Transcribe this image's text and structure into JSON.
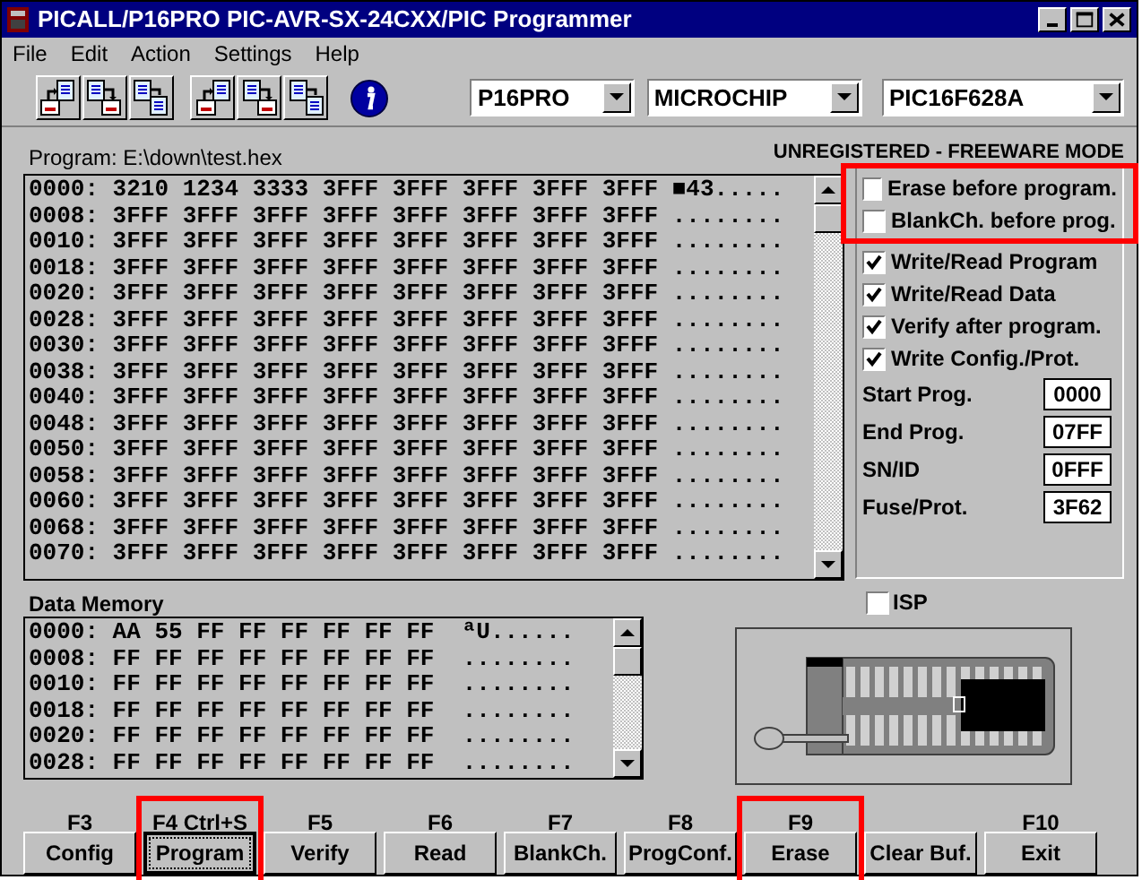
{
  "window": {
    "title": "PICALL/P16PRO PIC-AVR-SX-24CXX/PIC Programmer"
  },
  "menu": [
    "File",
    "Edit",
    "Action",
    "Settings",
    "Help"
  ],
  "toolbar": {
    "buttons": [
      {
        "kind": "load"
      },
      {
        "kind": "save"
      },
      {
        "kind": "saveas"
      },
      {
        "kind": "load"
      },
      {
        "kind": "save"
      },
      {
        "kind": "saveas"
      },
      {
        "kind": "info"
      }
    ],
    "dropdowns": [
      {
        "value": "P16PRO"
      },
      {
        "value": "MICROCHIP"
      },
      {
        "value": "PIC16F628A"
      }
    ]
  },
  "program": {
    "label": "Program: E:\\down\\test.hex",
    "mode": "UNREGISTERED - FREEWARE MODE",
    "lines": [
      "0000: 3210 1234 3333 3FFF 3FFF 3FFF 3FFF 3FFF ■43.....",
      "0008: 3FFF 3FFF 3FFF 3FFF 3FFF 3FFF 3FFF 3FFF ........",
      "0010: 3FFF 3FFF 3FFF 3FFF 3FFF 3FFF 3FFF 3FFF ........",
      "0018: 3FFF 3FFF 3FFF 3FFF 3FFF 3FFF 3FFF 3FFF ........",
      "0020: 3FFF 3FFF 3FFF 3FFF 3FFF 3FFF 3FFF 3FFF ........",
      "0028: 3FFF 3FFF 3FFF 3FFF 3FFF 3FFF 3FFF 3FFF ........",
      "0030: 3FFF 3FFF 3FFF 3FFF 3FFF 3FFF 3FFF 3FFF ........",
      "0038: 3FFF 3FFF 3FFF 3FFF 3FFF 3FFF 3FFF 3FFF ........",
      "0040: 3FFF 3FFF 3FFF 3FFF 3FFF 3FFF 3FFF 3FFF ........",
      "0048: 3FFF 3FFF 3FFF 3FFF 3FFF 3FFF 3FFF 3FFF ........",
      "0050: 3FFF 3FFF 3FFF 3FFF 3FFF 3FFF 3FFF 3FFF ........",
      "0058: 3FFF 3FFF 3FFF 3FFF 3FFF 3FFF 3FFF 3FFF ........",
      "0060: 3FFF 3FFF 3FFF 3FFF 3FFF 3FFF 3FFF 3FFF ........",
      "0068: 3FFF 3FFF 3FFF 3FFF 3FFF 3FFF 3FFF 3FFF ........",
      "0070: 3FFF 3FFF 3FFF 3FFF 3FFF 3FFF 3FFF 3FFF ........"
    ]
  },
  "options": [
    {
      "label": "Erase before program.",
      "checked": false,
      "highlighted": true
    },
    {
      "label": "BlankCh. before prog.",
      "checked": false,
      "highlighted": true
    },
    {
      "label": "Write/Read Program",
      "checked": true,
      "highlighted": false
    },
    {
      "label": "Write/Read Data",
      "checked": true,
      "highlighted": false
    },
    {
      "label": "Verify after program.",
      "checked": true,
      "highlighted": false
    },
    {
      "label": "Write Config./Prot.",
      "checked": true,
      "highlighted": false
    }
  ],
  "fields": [
    {
      "label": "Start Prog.",
      "value": "0000"
    },
    {
      "label": "End Prog.",
      "value": "07FF"
    },
    {
      "label": "SN/ID",
      "value": "0FFF"
    },
    {
      "label": "Fuse/Prot.",
      "value": "3F62"
    }
  ],
  "data_memory": {
    "label": "Data Memory",
    "lines": [
      "0000: AA 55 FF FF FF FF FF FF  ªU......",
      "0008: FF FF FF FF FF FF FF FF  ........",
      "0010: FF FF FF FF FF FF FF FF  ........",
      "0018: FF FF FF FF FF FF FF FF  ........",
      "0020: FF FF FF FF FF FF FF FF  ........",
      "0028: FF FF FF FF FF FF FF FF  ........"
    ]
  },
  "isp": {
    "label": "ISP",
    "checked": false
  },
  "buttons": [
    {
      "key": "F3",
      "label": "Config",
      "focused": false,
      "highlighted": false
    },
    {
      "key": "F4 Ctrl+S",
      "label": "Program",
      "focused": true,
      "highlighted": true
    },
    {
      "key": "F5",
      "label": "Verify",
      "focused": false,
      "highlighted": false
    },
    {
      "key": "F6",
      "label": "Read",
      "focused": false,
      "highlighted": false
    },
    {
      "key": "F7",
      "label": "BlankCh.",
      "focused": false,
      "highlighted": false
    },
    {
      "key": "F8",
      "label": "ProgConf.",
      "focused": false,
      "highlighted": false
    },
    {
      "key": "F9",
      "label": "Erase",
      "focused": false,
      "highlighted": true
    },
    {
      "label": "Clear Buf.",
      "focused": false,
      "highlighted": false
    },
    {
      "key": "F10",
      "label": "Exit",
      "focused": false,
      "highlighted": false
    }
  ]
}
